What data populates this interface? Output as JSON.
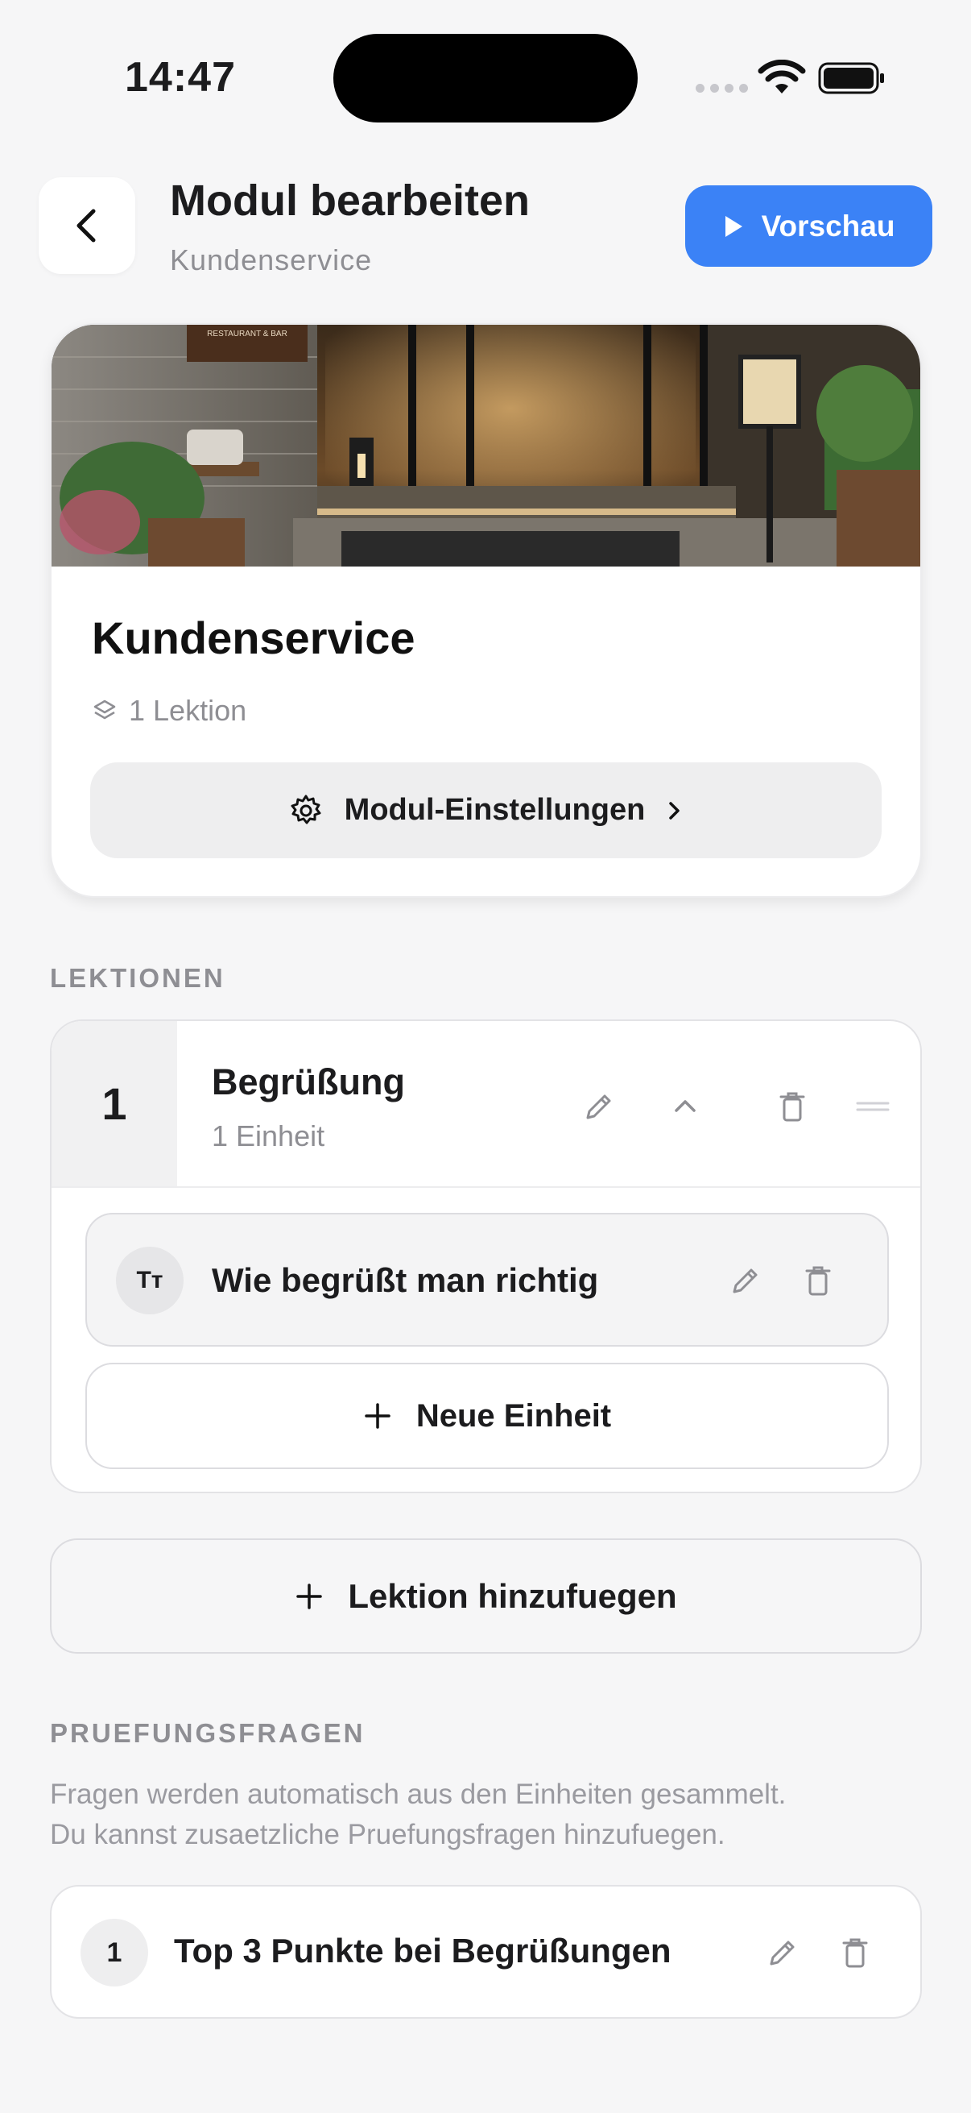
{
  "status_bar": {
    "time": "14:47"
  },
  "header": {
    "title": "Modul bearbeiten",
    "subtitle": "Kundenservice",
    "preview_label": "Vorschau"
  },
  "module": {
    "title": "Kundenservice",
    "lesson_count": "1 Lektion",
    "settings_label": "Modul-Einstellungen",
    "hero_sign_text": "RESTAURANT & BAR"
  },
  "lessons_section": {
    "label": "LEKTIONEN",
    "lessons": [
      {
        "number": "1",
        "title": "Begrüßung",
        "subtitle": "1 Einheit",
        "units": [
          {
            "icon_text": "Tт",
            "title": "Wie begrüßt man richtig"
          }
        ],
        "new_unit_label": "Neue Einheit"
      }
    ],
    "add_lesson_label": "Lektion hinzufuegen"
  },
  "exam_section": {
    "label": "PRUEFUNGSFRAGEN",
    "description_line1": "Fragen werden automatisch aus den Einheiten gesammelt.",
    "description_line2": "Du kannst zusaetzliche Pruefungsfragen hinzufuegen.",
    "questions": [
      {
        "number": "1",
        "title": "Top 3 Punkte bei Begrüßungen"
      }
    ]
  },
  "colors": {
    "accent": "#3b82f6",
    "background": "#f6f6f7",
    "muted_text": "#8e8e93"
  }
}
